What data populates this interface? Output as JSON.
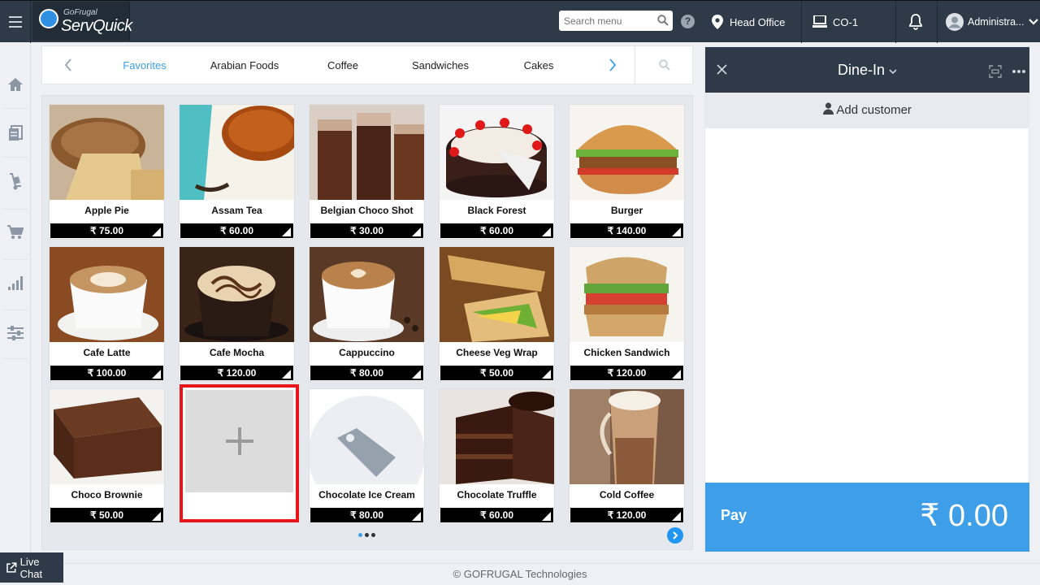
{
  "topbar": {
    "logo_small": "GoFrugal",
    "logo_main": "ServQuick",
    "search_placeholder": "Search menu",
    "location": "Head Office",
    "counter": "CO-1",
    "user": "Administra..."
  },
  "categories": {
    "tabs": [
      "Favorites",
      "Arabian Foods",
      "Coffee",
      "Sandwiches",
      "Cakes"
    ],
    "active": "Favorites"
  },
  "items": [
    {
      "name": "Apple Pie",
      "price": "₹ 75.00"
    },
    {
      "name": "Assam Tea",
      "price": "₹ 60.00"
    },
    {
      "name": "Belgian Choco Shot",
      "price": "₹ 30.00"
    },
    {
      "name": "Black Forest",
      "price": "₹ 60.00"
    },
    {
      "name": "Burger",
      "price": "₹ 140.00"
    },
    {
      "name": "Cafe Latte",
      "price": "₹ 100.00"
    },
    {
      "name": "Cafe Mocha",
      "price": "₹ 120.00"
    },
    {
      "name": "Cappuccino",
      "price": "₹ 80.00"
    },
    {
      "name": "Cheese Veg Wrap",
      "price": "₹ 50.00"
    },
    {
      "name": "Chicken Sandwich",
      "price": "₹ 120.00"
    },
    {
      "name": "Choco Brownie",
      "price": "₹ 50.00"
    },
    {
      "name": "Chocolate Ice Cream",
      "price": "₹ 80.00"
    },
    {
      "name": "Chocolate Truffle",
      "price": "₹ 60.00"
    },
    {
      "name": "Cold Coffee",
      "price": "₹ 120.00"
    }
  ],
  "order": {
    "mode": "Dine-In",
    "add_customer": "Add customer",
    "pay_label": "Pay",
    "total": "₹ 0.00"
  },
  "footer": {
    "copyright": "© GOFRUGAL Technologies",
    "live_chat": "Live Chat"
  },
  "colors": {
    "header": "#2e3a47",
    "accent": "#3e9fe8",
    "highlight": "#e8161b"
  }
}
